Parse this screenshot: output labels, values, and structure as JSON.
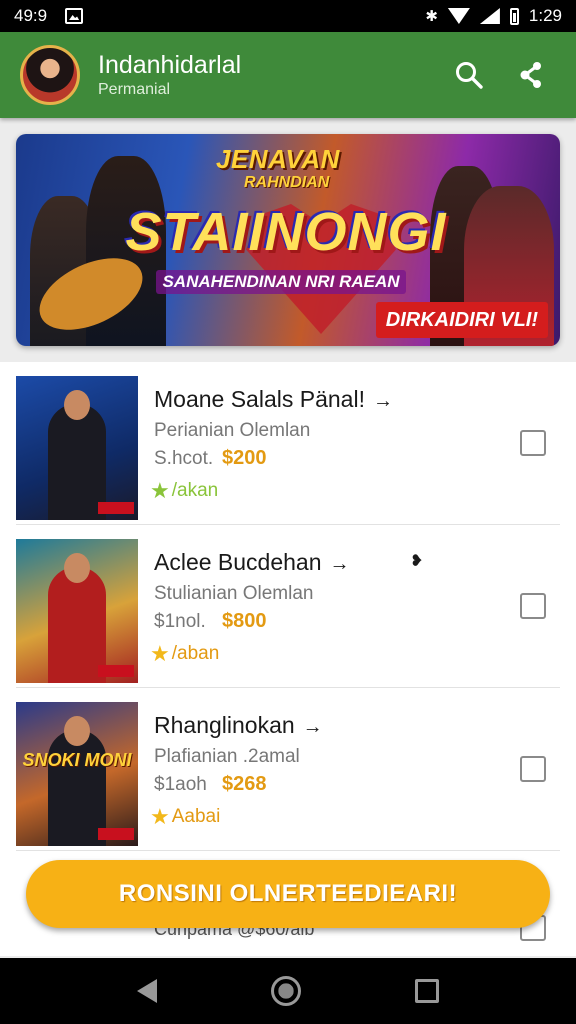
{
  "status_bar": {
    "time_left": "49:9",
    "time_right": "1:29",
    "icons": [
      "gallery-icon",
      "bluetooth-icon",
      "wifi-icon",
      "signal-icon",
      "battery-icon"
    ]
  },
  "app_bar": {
    "title": "Indanhidarlal",
    "subtitle": "Permanial",
    "background": "#3f8a3a",
    "actions": [
      "search-icon",
      "share-icon"
    ]
  },
  "banner": {
    "small_title": "JENAVAN",
    "small_subtitle": "RAHNDIAN",
    "big_title": "STAIINONGI",
    "tagline": "SANAHENDINAN NRI RAEAN",
    "cta": "DIRKAIDIRI VLI!"
  },
  "list": {
    "items": [
      {
        "title": "Moane Salals Pänal!",
        "arrow": "→",
        "extra": "",
        "subtitle": "Perianian Olemlan",
        "stock": "S.hcot.",
        "price": "$200",
        "rating": "/akan",
        "thumb_text": ""
      },
      {
        "title": "Aclee Bucdehan",
        "arrow": "→",
        "extra": "❥",
        "subtitle": "Stulianian Olemlan",
        "stock": "$1nol.",
        "price": "$800",
        "rating": "/aban",
        "thumb_text": ""
      },
      {
        "title": "Rhanglinokan",
        "arrow": "→",
        "extra": "",
        "subtitle": "Plafianian .2amal",
        "stock": "$1aoh",
        "price": "$268",
        "rating": "Aabai",
        "thumb_text": "SNOKI MONI"
      }
    ],
    "partial_item_text": "Cunpama @$60/alb"
  },
  "cta_button": {
    "label": "RONSINI OLNERTEEDIEARI!",
    "color": "#f7b115"
  },
  "colors": {
    "price": "#e39a12",
    "star": "#8ac43a",
    "star_alt": "#f2b81a"
  }
}
